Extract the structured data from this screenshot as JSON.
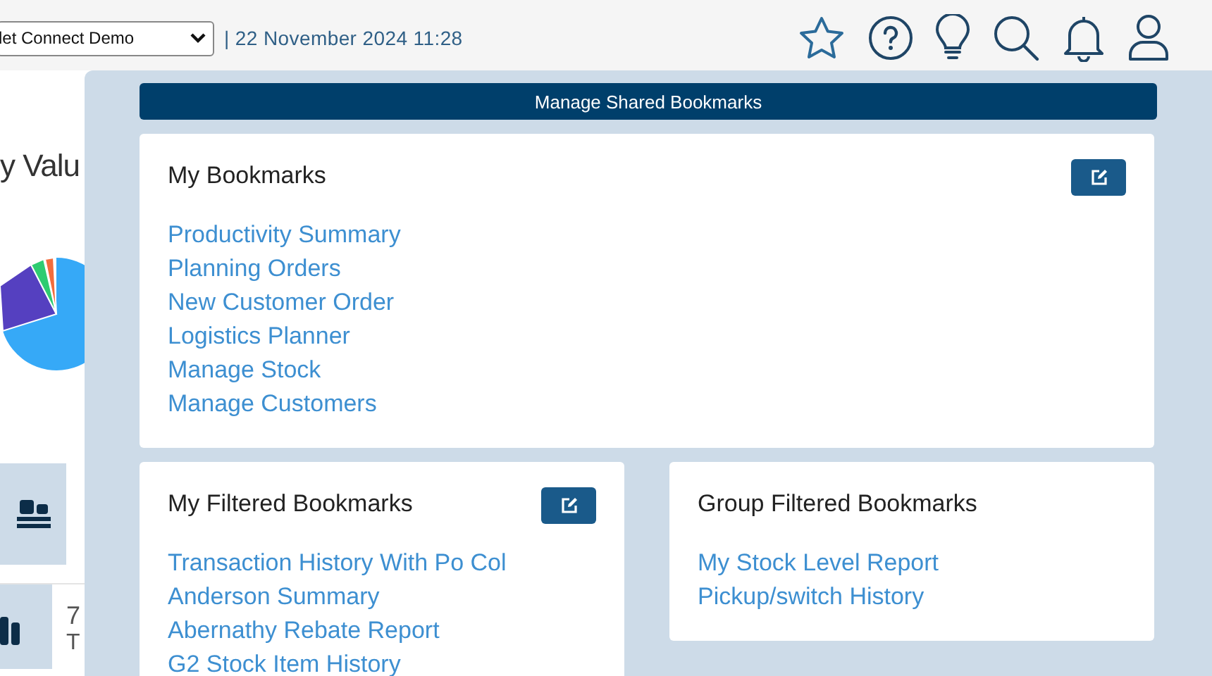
{
  "header": {
    "select_value": "let Connect Demo",
    "datetime": "| 22 November 2024 11:28"
  },
  "background": {
    "title": "y Valu",
    "tiles": [
      {
        "kind": "pallet"
      },
      {
        "kind": "bars",
        "value": "7",
        "label": "T"
      }
    ]
  },
  "bookmarks_panel": {
    "title": "Manage Shared Bookmarks",
    "cards": [
      {
        "title": "My Bookmarks",
        "editable": true,
        "links": [
          "Productivity Summary",
          "Planning Orders",
          "New Customer Order",
          "Logistics Planner",
          "Manage Stock",
          "Manage Customers"
        ]
      },
      {
        "title": "My Filtered Bookmarks",
        "editable": true,
        "links": [
          "Transaction History With Po Col",
          "Anderson Summary",
          "Abernathy Rebate Report",
          "G2 Stock Item History"
        ]
      },
      {
        "title": "Group Filtered Bookmarks",
        "editable": false,
        "links": [
          "My Stock Level Report",
          "Pickup/switch History"
        ]
      }
    ]
  }
}
